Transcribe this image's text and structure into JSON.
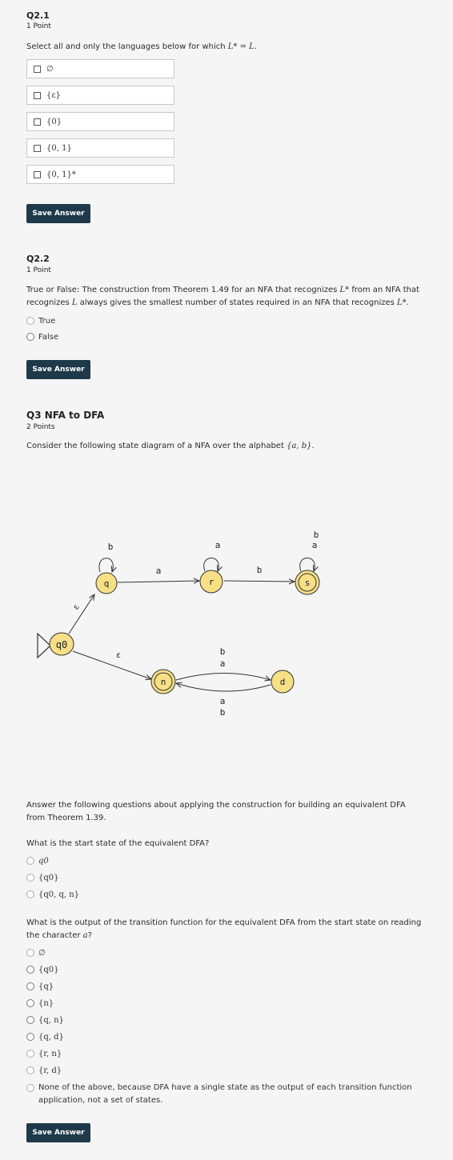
{
  "q21": {
    "number": "Q2.1",
    "points": "1 Point",
    "prompt_pre": "Select all and only the languages below for which ",
    "prompt_math": "L* = L.",
    "options": [
      "∅",
      "{ε}",
      "{0}",
      "{0, 1}",
      "{0, 1}*"
    ],
    "save_label": "Save Answer"
  },
  "q22": {
    "number": "Q2.2",
    "points": "1 Point",
    "prompt_a": "True or False: The construction from Theorem 1.49 for an NFA that recognizes ",
    "prompt_b": "L*",
    "prompt_c": " from an NFA that",
    "prompt_d": "recognizes ",
    "prompt_e": "L",
    "prompt_f": " always gives the smallest number of states required in an NFA that recognizes ",
    "prompt_g": "L*",
    "prompt_h": ".",
    "options": [
      "True",
      "False"
    ],
    "save_label": "Save Answer"
  },
  "q3": {
    "title": "Q3 NFA to DFA",
    "points": "2 Points",
    "prompt_pre": "Consider the following state diagram of a NFA over the alphabet ",
    "prompt_math": "{a, b}.",
    "diagram": {
      "states": [
        "q0",
        "q",
        "r",
        "s",
        "n",
        "d"
      ],
      "edge_labels": {
        "q0_q": "ε",
        "q0_n": "ε",
        "q_loop": "b",
        "q_r": "a",
        "r_loop": "a",
        "r_s": "b",
        "s_loop_top": "b",
        "s_loop_bottom": "a",
        "n_d_1": "b",
        "n_d_2": "a",
        "d_n_1": "a",
        "d_n_2": "b"
      }
    },
    "answer_intro_1": "Answer the following questions about applying the construction for building an equivalent DFA",
    "answer_intro_2": "from Theorem 1.39.",
    "sub1": {
      "question": "What is the start state of the equivalent DFA?",
      "options": [
        "q0",
        "{q0}",
        "{q0, q, n}"
      ]
    },
    "sub2": {
      "question_1": "What is the output of the transition function for the equivalent DFA from the start state on reading",
      "question_2": "the character ",
      "question_math": "a",
      "question_end": "?",
      "options": [
        "∅",
        "{q0}",
        "{q}",
        "{n}",
        "{q, n}",
        "{q, d}",
        "{r, n}",
        "{r, d}"
      ],
      "none_1": "None of the above, because DFA have a single state as the output of each transition function",
      "none_2": "application, not a set of states."
    },
    "save_label": "Save Answer"
  }
}
